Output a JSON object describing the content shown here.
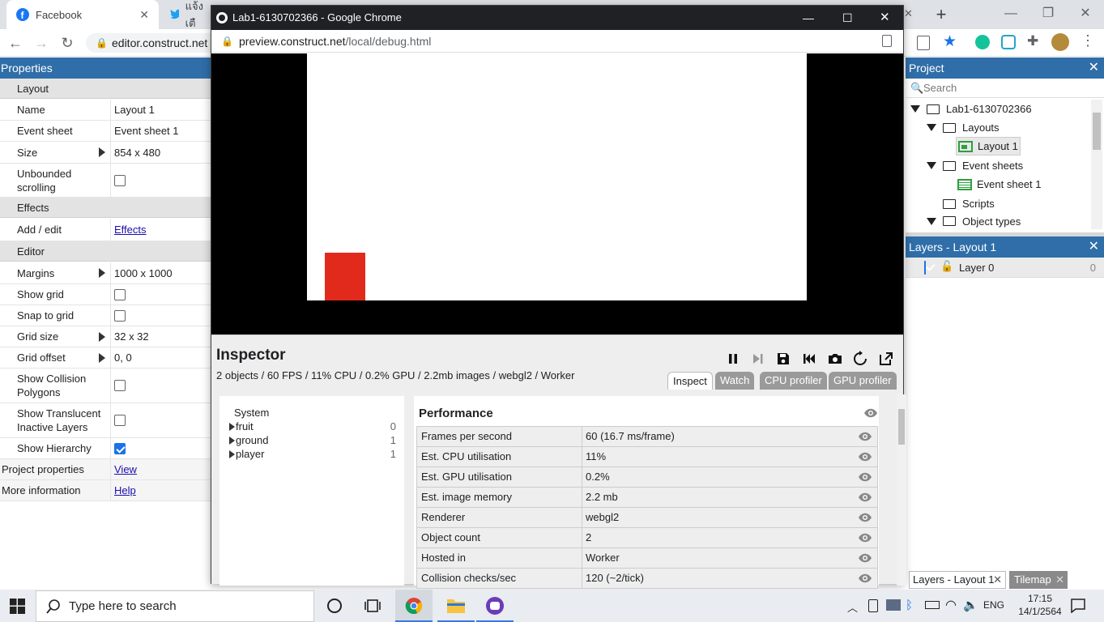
{
  "background_browser": {
    "tabs": [
      {
        "label": "Facebook",
        "icon": "facebook-icon",
        "color": "#1877f2"
      },
      {
        "label": "แจ้งเตื",
        "icon": "twitter-icon",
        "color": "#1da1f2"
      }
    ],
    "address": "editor.construct.net"
  },
  "properties": {
    "header": "Properties",
    "sections": {
      "layout": "Layout",
      "effects": "Effects",
      "editor": "Editor"
    },
    "rows": {
      "name": {
        "label": "Name",
        "value": "Layout 1"
      },
      "event_sheet": {
        "label": "Event sheet",
        "value": "Event sheet 1"
      },
      "size": {
        "label": "Size",
        "value": "854 x 480"
      },
      "unbounded": {
        "label": "Unbounded scrolling",
        "checked": false
      },
      "add_edit": {
        "label": "Add / edit",
        "value": "Effects"
      },
      "margins": {
        "label": "Margins",
        "value": "1000 x 1000"
      },
      "show_grid": {
        "label": "Show grid",
        "checked": false
      },
      "snap_grid": {
        "label": "Snap to grid",
        "checked": false
      },
      "grid_size": {
        "label": "Grid size",
        "value": "32 x 32"
      },
      "grid_offset": {
        "label": "Grid offset",
        "value": "0, 0"
      },
      "collision": {
        "label": "Show Collision Polygons",
        "checked": false
      },
      "translucent": {
        "label": "Show Translucent Inactive Layers",
        "checked": false
      },
      "hierarchy": {
        "label": "Show Hierarchy",
        "checked": true
      },
      "project_props": {
        "label": "Project properties",
        "value": "View"
      },
      "more_info": {
        "label": "More information",
        "value": "Help"
      }
    }
  },
  "project": {
    "header": "Project",
    "search_placeholder": "Search",
    "tree": {
      "root": "Lab1-6130702366",
      "layouts": "Layouts",
      "layout1": "Layout 1",
      "event_sheets": "Event sheets",
      "event_sheet1": "Event sheet 1",
      "scripts": "Scripts",
      "object_types": "Object types"
    }
  },
  "layers": {
    "header": "Layers - Layout 1",
    "items": [
      {
        "name": "Layer 0",
        "count": "0"
      }
    ]
  },
  "bottom_tabs": [
    "Layers - Layout 1",
    "Tilemap"
  ],
  "popup": {
    "title": "Lab1-6130702366 - Google Chrome",
    "url_host": "preview.construct.net",
    "url_path": "/local/debug.html"
  },
  "inspector": {
    "title": "Inspector",
    "stats": "2 objects / 60 FPS / 11% CPU / 0.2% GPU / 2.2mb images / webgl2 / Worker",
    "tabs": [
      "Inspect",
      "Watch",
      "CPU profiler",
      "GPU profiler"
    ],
    "active_tab": "Inspect",
    "objects": [
      {
        "name": "System",
        "count": ""
      },
      {
        "name": "fruit",
        "count": "0"
      },
      {
        "name": "ground",
        "count": "1"
      },
      {
        "name": "player",
        "count": "1"
      }
    ],
    "performance_title": "Performance",
    "performance": [
      {
        "key": "Frames per second",
        "value": "60 (16.7 ms/frame)"
      },
      {
        "key": "Est. CPU utilisation",
        "value": "11%"
      },
      {
        "key": "Est. GPU utilisation",
        "value": "0.2%"
      },
      {
        "key": "Est. image memory",
        "value": "2.2 mb"
      },
      {
        "key": "Renderer",
        "value": "webgl2"
      },
      {
        "key": "Object count",
        "value": "2"
      },
      {
        "key": "Hosted in",
        "value": "Worker"
      },
      {
        "key": "Collision checks/sec",
        "value": "120 (~2/tick)"
      }
    ]
  },
  "game": {
    "player_color": "#e22a1c"
  },
  "taskbar": {
    "search_placeholder": "Type here to search",
    "lang": "ENG",
    "time": "17:15",
    "date": "14/1/2564"
  }
}
